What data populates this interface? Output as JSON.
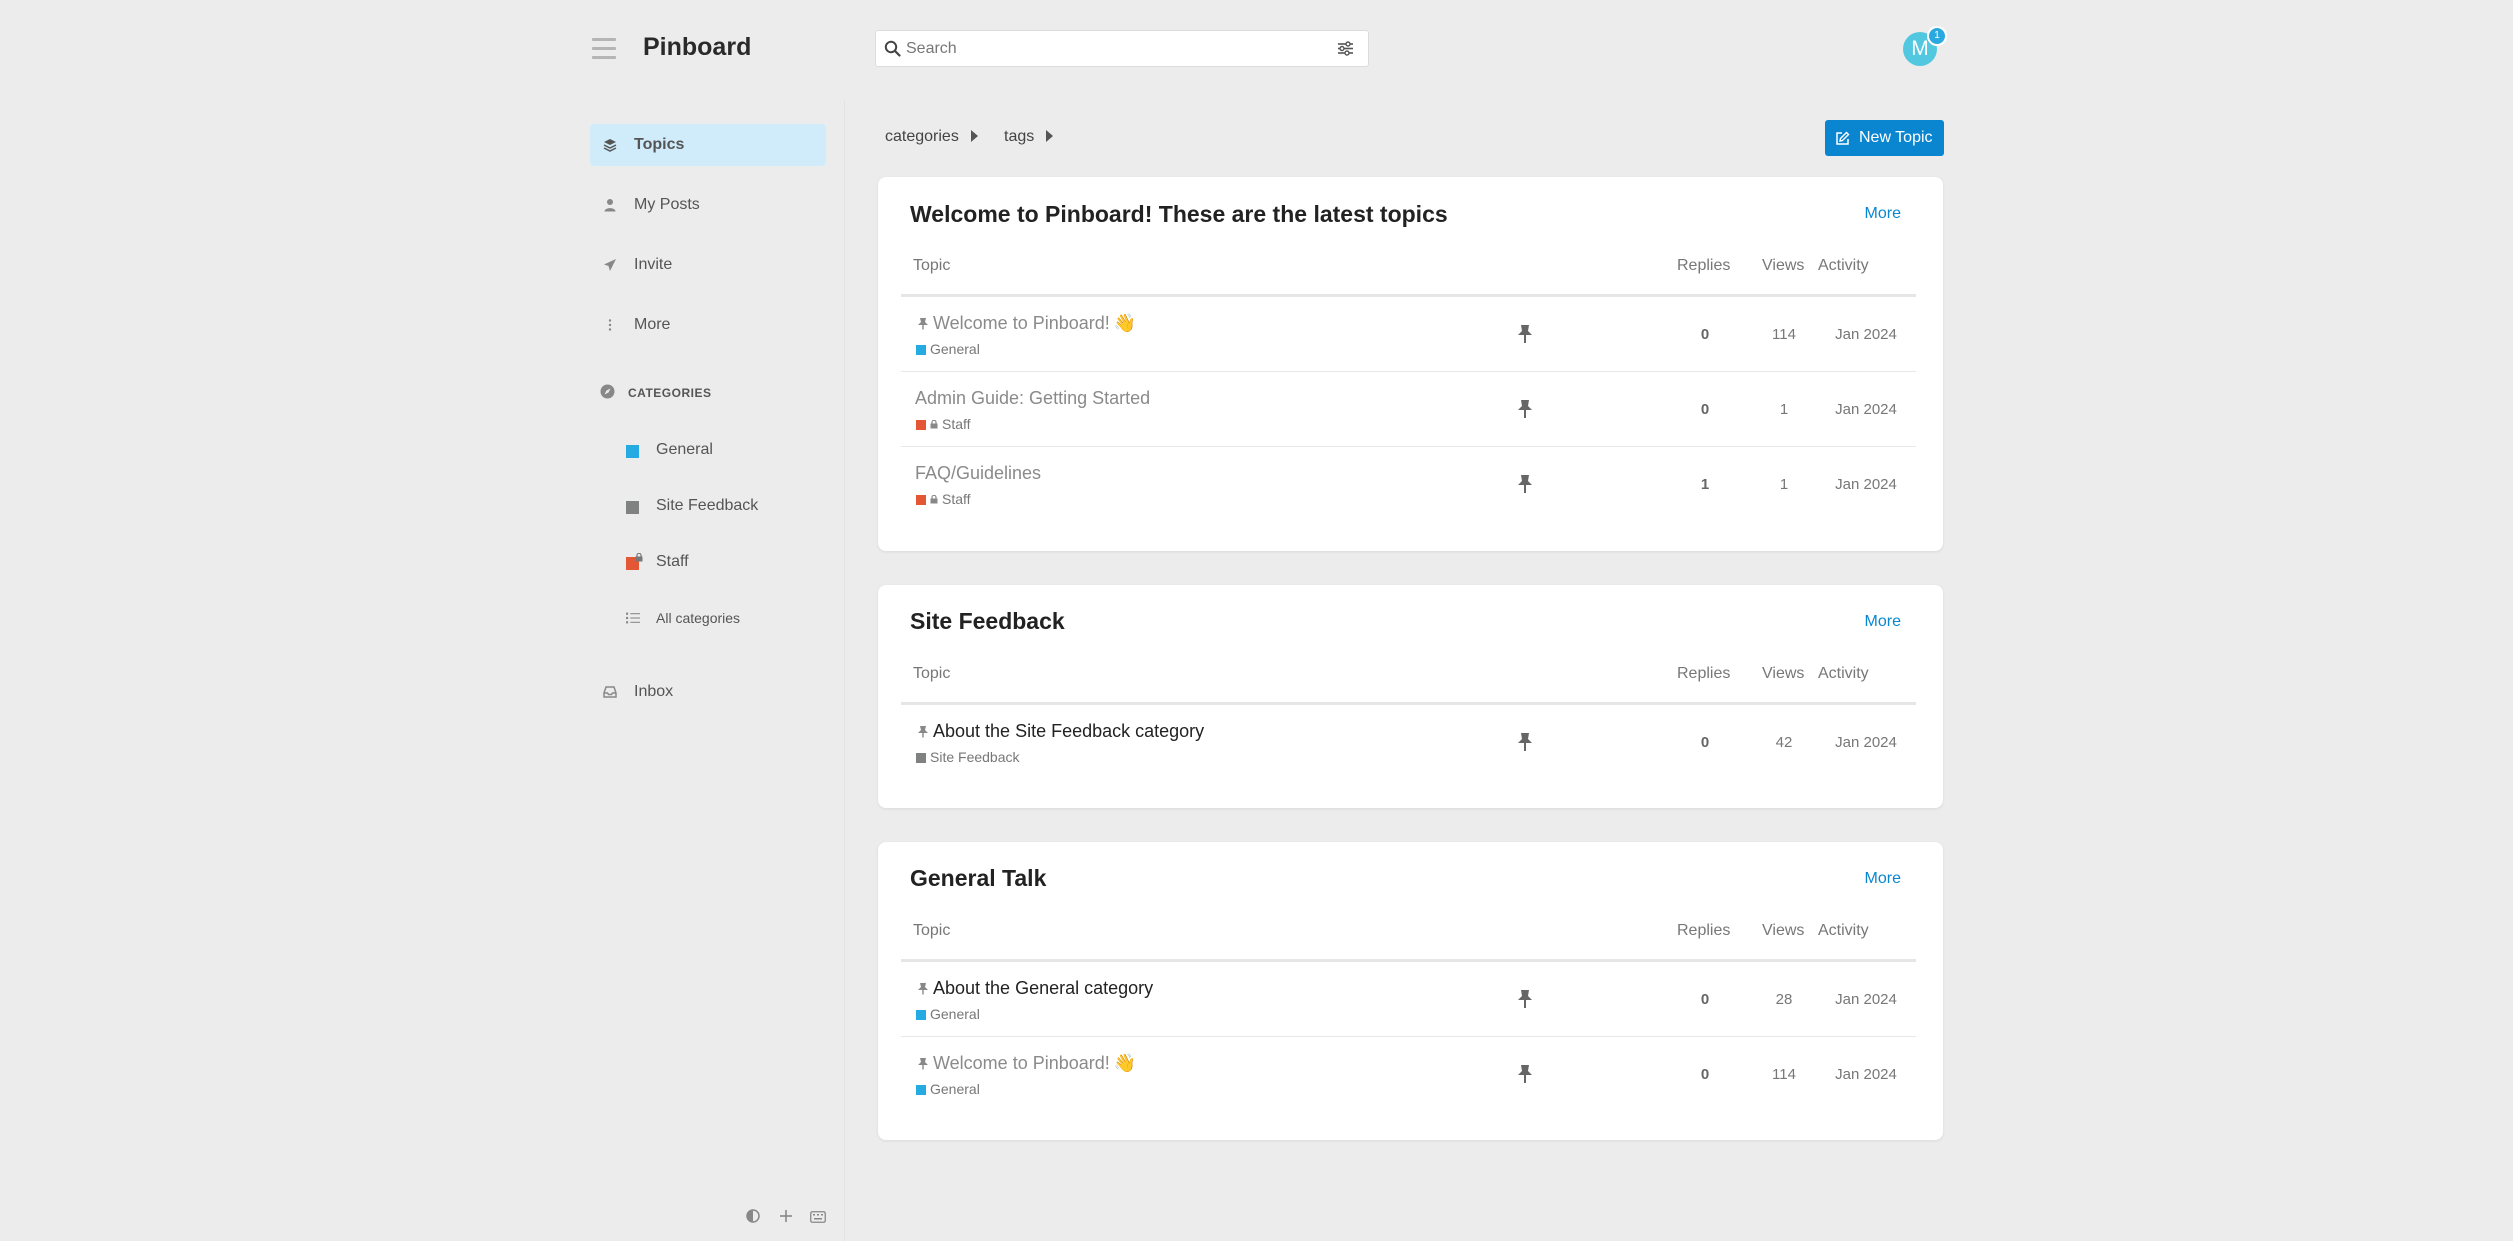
{
  "header": {
    "logo": "Pinboard",
    "search_placeholder": "Search",
    "avatar_letter": "M",
    "notification_count": "1"
  },
  "sidebar": {
    "nav": [
      {
        "label": "Topics",
        "icon": "layers-icon",
        "active": true
      },
      {
        "label": "My Posts",
        "icon": "user-icon"
      },
      {
        "label": "Invite",
        "icon": "paper-plane-icon"
      },
      {
        "label": "More",
        "icon": "ellipsis-vertical-icon"
      }
    ],
    "categories_heading": "CATEGORIES",
    "categories": [
      {
        "label": "General",
        "color": "#25aae1"
      },
      {
        "label": "Site Feedback",
        "color": "#808281"
      },
      {
        "label": "Staff",
        "color": "#e45735"
      },
      {
        "label": "All categories"
      }
    ],
    "inbox": "Inbox"
  },
  "main": {
    "breadcrumbs": [
      "categories",
      "tags"
    ],
    "new_topic": "New Topic",
    "columns": {
      "topic": "Topic",
      "replies": "Replies",
      "views": "Views",
      "activity": "Activity"
    },
    "more_label": "More",
    "sections": [
      {
        "title": "Welcome to Pinboard! These are the latest topics",
        "topics": [
          {
            "title": "Welcome to Pinboard!",
            "emoji": "👋",
            "category": "General",
            "cat_color": "#25aae1",
            "replies": "0",
            "views": "114",
            "activity": "Jan 2024"
          },
          {
            "title": "Admin Guide: Getting Started",
            "category": "Staff",
            "cat_color": "#e45735",
            "replies": "0",
            "views": "1",
            "activity": "Jan 2024"
          },
          {
            "title": "FAQ/Guidelines",
            "category": "Staff",
            "cat_color": "#e45735",
            "replies": "1",
            "views": "1",
            "activity": "Jan 2024"
          }
        ]
      },
      {
        "title": "Site Feedback",
        "topics": [
          {
            "title": "About the Site Feedback category",
            "category": "Site Feedback",
            "cat_color": "#808281",
            "replies": "0",
            "views": "42",
            "activity": "Jan 2024"
          }
        ]
      },
      {
        "title": "General Talk",
        "topics": [
          {
            "title": "About the General category",
            "category": "General",
            "cat_color": "#25aae1",
            "replies": "0",
            "views": "28",
            "activity": "Jan 2024"
          },
          {
            "title": "Welcome to Pinboard!",
            "emoji": "👋",
            "category": "General",
            "cat_color": "#25aae1",
            "replies": "0",
            "views": "114",
            "activity": "Jan 2024"
          }
        ]
      }
    ]
  }
}
